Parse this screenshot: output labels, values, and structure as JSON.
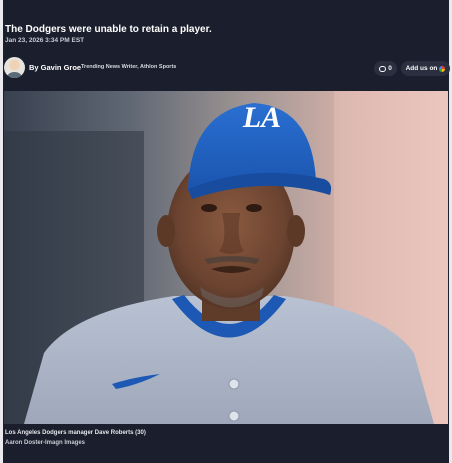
{
  "article": {
    "headline": "The Dodgers were unable to retain a player.",
    "date": "Jan 23, 2026 3:34 PM EST"
  },
  "author": {
    "byline": "By Gavin Groe",
    "role": "Trending News Writer, Athlon Sports"
  },
  "actions": {
    "comment_count": "0",
    "add_us_label": "Add us on"
  },
  "image": {
    "caption": "Los Angeles Dodgers manager Dave Roberts (30)",
    "credit": "Aaron Doster-Imagn Images",
    "cap_logo": "LA"
  },
  "colors": {
    "background": "#1b1e2c",
    "button": "#2b2f3f",
    "dodger_blue": "#1e5fc2"
  },
  "icons": [
    "avatar",
    "comment-icon",
    "google-icon"
  ]
}
